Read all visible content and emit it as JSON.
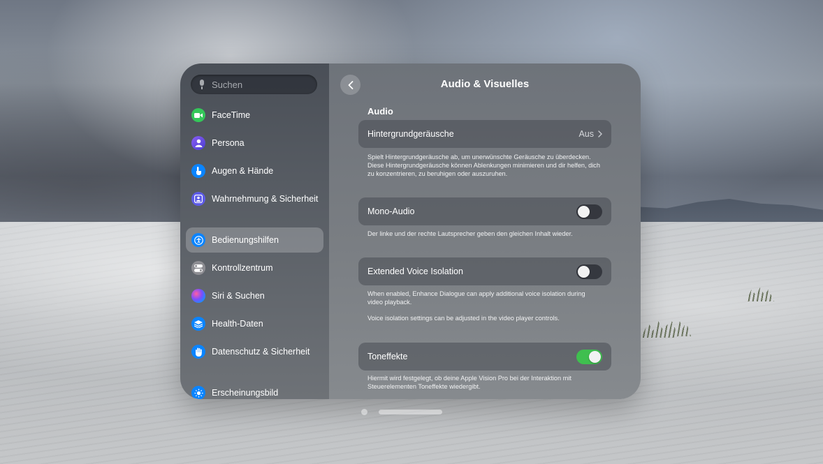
{
  "search": {
    "placeholder": "Suchen"
  },
  "sidebar": {
    "items": [
      {
        "label": "FaceTime",
        "icon": "video-icon",
        "color": "#34c759"
      },
      {
        "label": "Persona",
        "icon": "persona-icon",
        "color": "#5e5ce6"
      },
      {
        "label": "Augen & Hände",
        "icon": "hand-pointer-icon",
        "color": "#0a84ff"
      },
      {
        "label": "Wahrnehmung & Sicherheit",
        "icon": "person-badge-icon",
        "color": "#5e5ce6"
      },
      {
        "label": "Bedienungshilfen",
        "icon": "accessibility-icon",
        "color": "#0a84ff",
        "selected": true
      },
      {
        "label": "Kontrollzentrum",
        "icon": "toggles-icon",
        "color": "#8e8e93"
      },
      {
        "label": "Siri & Suchen",
        "icon": "siri-icon",
        "color": "#6a5acd"
      },
      {
        "label": "Health-Daten",
        "icon": "stack-icon",
        "color": "#0a84ff"
      },
      {
        "label": "Datenschutz & Sicherheit",
        "icon": "hand-raised-icon",
        "color": "#0a84ff"
      },
      {
        "label": "Erscheinungsbild",
        "icon": "sun-icon",
        "color": "#0a84ff"
      }
    ]
  },
  "main": {
    "title": "Audio & Visuelles",
    "section": "Audio",
    "rows": [
      {
        "label": "Hintergrundgeräusche",
        "value": "Aus",
        "description": "Spielt Hintergrundgeräusche ab, um unerwünschte Geräusche zu überdecken. Diese Hintergrundgeräusche können Ablenkungen minimieren und dir helfen, dich zu konzentrieren, zu beruhigen oder auszuruhen."
      },
      {
        "label": "Mono-Audio",
        "toggle": false,
        "description": "Der linke und der rechte Lautsprecher geben den gleichen Inhalt wieder."
      },
      {
        "label": "Extended Voice Isolation",
        "toggle": false,
        "description": "When enabled, Enhance Dialogue can apply additional voice isolation during video playback.",
        "description2": "Voice isolation settings can be adjusted in the video player controls."
      },
      {
        "label": "Toneffekte",
        "toggle": true,
        "description": "Hiermit wird festgelegt, ob deine Apple Vision Pro bei der Interaktion mit Steuerelementen Toneffekte wiedergibt."
      }
    ]
  },
  "colors": {
    "toggle_on": "#3fbf4f",
    "accent": "#0a84ff"
  }
}
